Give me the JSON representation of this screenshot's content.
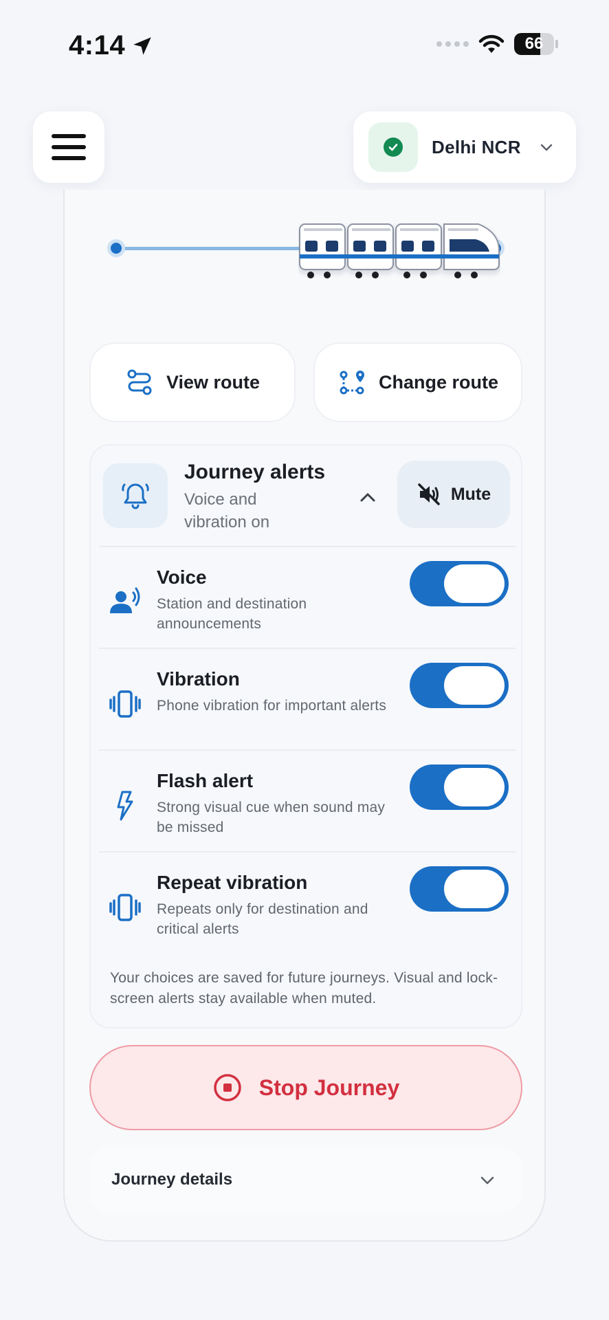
{
  "status_bar": {
    "time": "4:14",
    "battery_level": "66",
    "battery_fraction": 0.66
  },
  "header": {
    "menu_icon": "hamburger-icon",
    "city": "Delhi NCR",
    "city_status_icon": "check-circle-icon"
  },
  "colors": {
    "accent": "#1b6fc5",
    "danger": "#d2303f",
    "success": "#128a52"
  },
  "route_actions": {
    "view_route": "View route",
    "change_route": "Change route"
  },
  "journey_alerts": {
    "title": "Journey alerts",
    "subtitle": "Voice and vibration on",
    "mute_label": "Mute",
    "options": [
      {
        "title": "Voice",
        "description": "Station and destination announcements",
        "enabled": true,
        "icon": "voice-icon"
      },
      {
        "title": "Vibration",
        "description": "Phone vibration for important alerts",
        "enabled": true,
        "icon": "vibration-icon"
      },
      {
        "title": "Flash alert",
        "description": "Strong visual cue when sound may be missed",
        "enabled": true,
        "icon": "flash-icon"
      },
      {
        "title": "Repeat vibration",
        "description": "Repeats only for destination and critical alerts",
        "enabled": true,
        "icon": "repeat-vibration-icon"
      }
    ],
    "note": "Your choices are saved for future journeys. Visual and lock-screen alerts stay available when muted."
  },
  "stop_journey_label": "Stop Journey",
  "journey_details_label": "Journey details"
}
